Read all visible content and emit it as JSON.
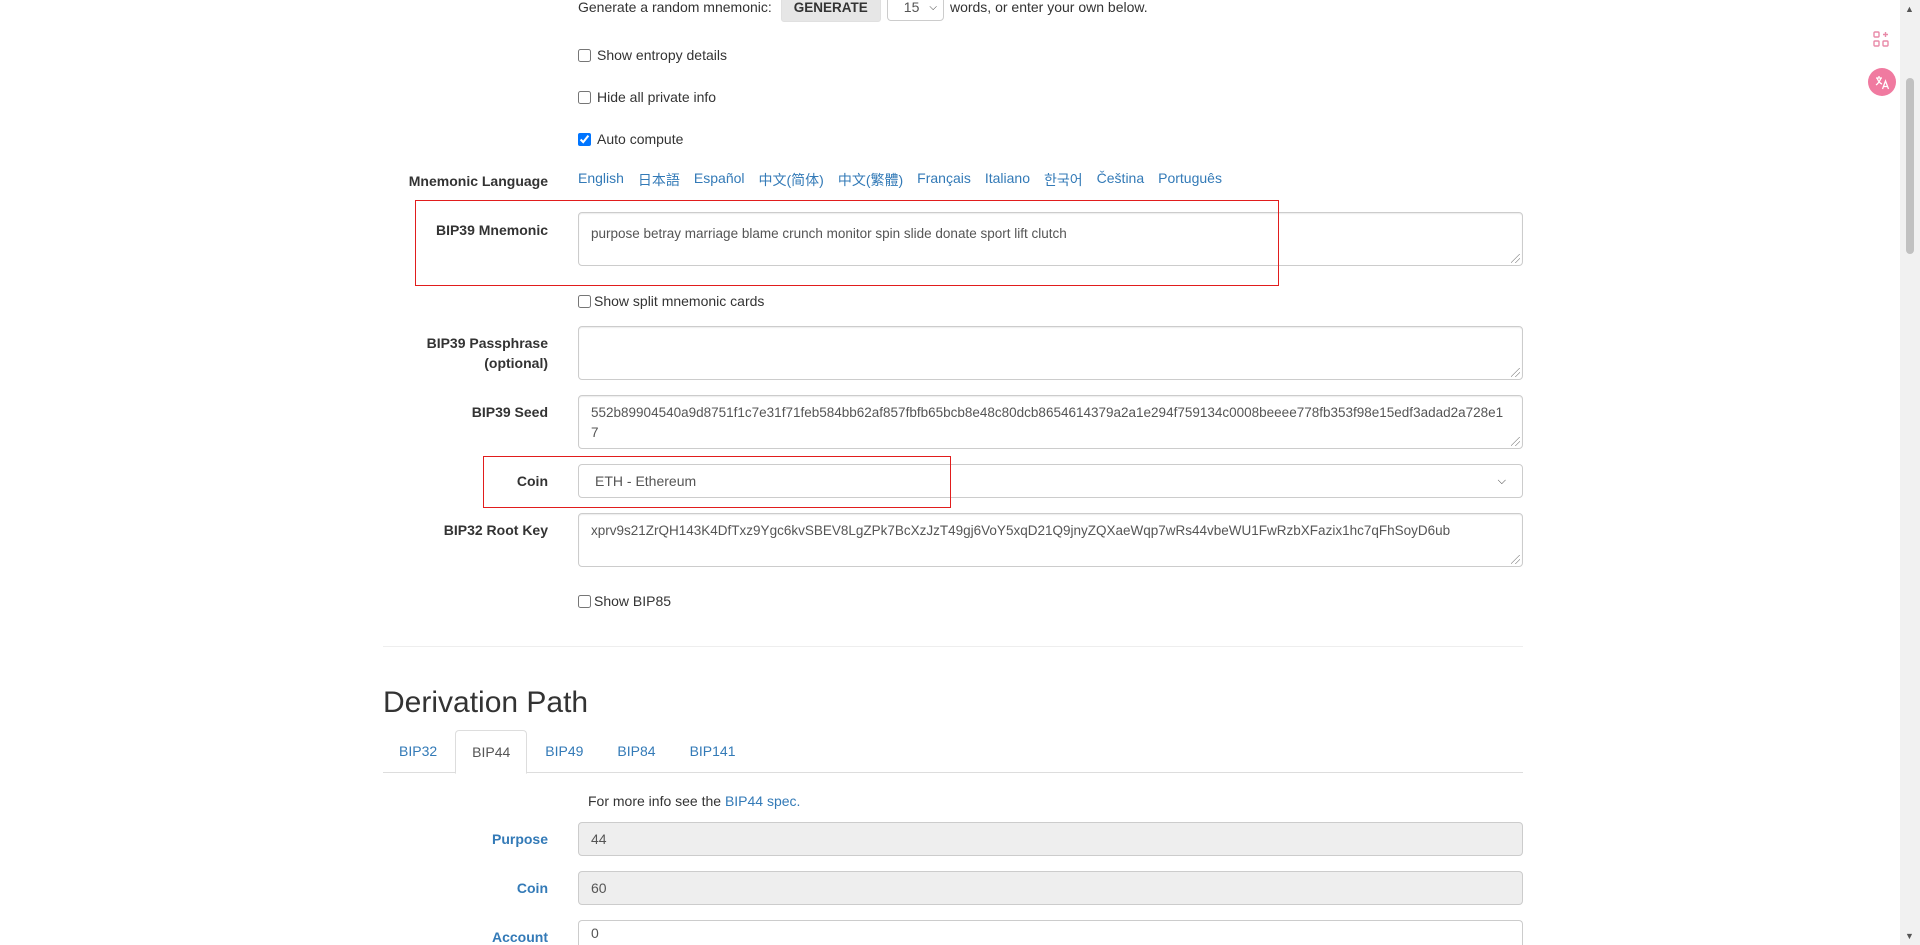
{
  "generate": {
    "prefix": "Generate a random mnemonic:",
    "button_label": "GENERATE",
    "word_count": "15",
    "suffix": "words, or enter your own below."
  },
  "options": {
    "show_entropy": "Show entropy details",
    "hide_private": "Hide all private info",
    "auto_compute": "Auto compute"
  },
  "mnemonic_language": {
    "label": "Mnemonic Language",
    "languages": [
      "English",
      "日本語",
      "Español",
      "中文(简体)",
      "中文(繁體)",
      "Français",
      "Italiano",
      "한국어",
      "Čeština",
      "Português"
    ]
  },
  "bip39_mnemonic": {
    "label": "BIP39 Mnemonic",
    "value": "purpose betray marriage blame crunch monitor spin slide donate sport lift clutch"
  },
  "split_cards": "Show split mnemonic cards",
  "passphrase": {
    "label_line1": "BIP39 Passphrase",
    "label_line2": "(optional)",
    "value": ""
  },
  "seed": {
    "label": "BIP39 Seed",
    "value": "552b89904540a9d8751f1c7e31f71feb584bb62af857fbfb65bcb8e48c80dcb8654614379a2a1e294f759134c0008beeee778fb353f98e15edf3adad2a728e17"
  },
  "coin": {
    "label": "Coin",
    "value": "ETH - Ethereum"
  },
  "root_key": {
    "label": "BIP32 Root Key",
    "value": "xprv9s21ZrQH143K4DfTxz9Ygc6kvSBEV8LgZPk7BcXzJzT49gj6VoY5xqD21Q9jnyZQXaeWqp7wRs44vbeWU1FwRzbXFazix1hc7qFhSoyD6ub"
  },
  "bip85": "Show BIP85",
  "derivation": {
    "heading": "Derivation Path",
    "tabs": [
      "BIP32",
      "BIP44",
      "BIP49",
      "BIP84",
      "BIP141"
    ],
    "active_tab": "BIP44",
    "info_prefix": "For more info see the",
    "info_link": "BIP44 spec.",
    "purpose_label": "Purpose",
    "purpose_value": "44",
    "coin_label": "Coin",
    "coin_value": "60",
    "account_label": "Account",
    "account_value": "0"
  },
  "colors": {
    "link": "#337ab7",
    "highlight_box": "#e11d1d",
    "readonly_bg": "#eeeeee"
  },
  "icons": [
    "chevron-down-icon",
    "apps-icon",
    "translate-icon",
    "resize-grip-icon"
  ]
}
